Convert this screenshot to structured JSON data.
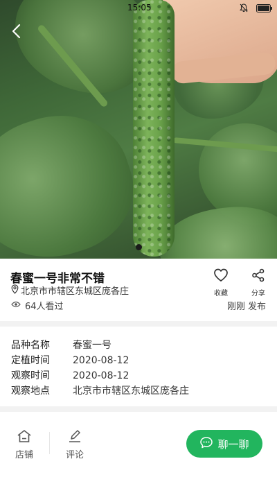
{
  "status_bar": {
    "time": "15:05"
  },
  "post": {
    "title": "春蜜一号非常不错",
    "location": "北京市市辖区东城区庞各庄",
    "views": "64人看过",
    "published": "刚刚 发布"
  },
  "actions": {
    "favorite_label": "收藏",
    "share_label": "分享"
  },
  "details": [
    {
      "key": "品种名称",
      "value": "春蜜一号"
    },
    {
      "key": "定植时间",
      "value": "2020-08-12"
    },
    {
      "key": "观察时间",
      "value": "2020-08-12"
    },
    {
      "key": "观察地点",
      "value": "北京市市辖区东城区庞各庄"
    }
  ],
  "bottom_bar": {
    "store_label": "店铺",
    "comment_label": "评论",
    "chat_label": "聊一聊"
  },
  "colors": {
    "accent_green": "#22b55e"
  },
  "icons": [
    "back-arrow",
    "bell-mute",
    "battery",
    "location-pin",
    "eye",
    "heart",
    "share",
    "store",
    "pen",
    "chat-bubble"
  ]
}
